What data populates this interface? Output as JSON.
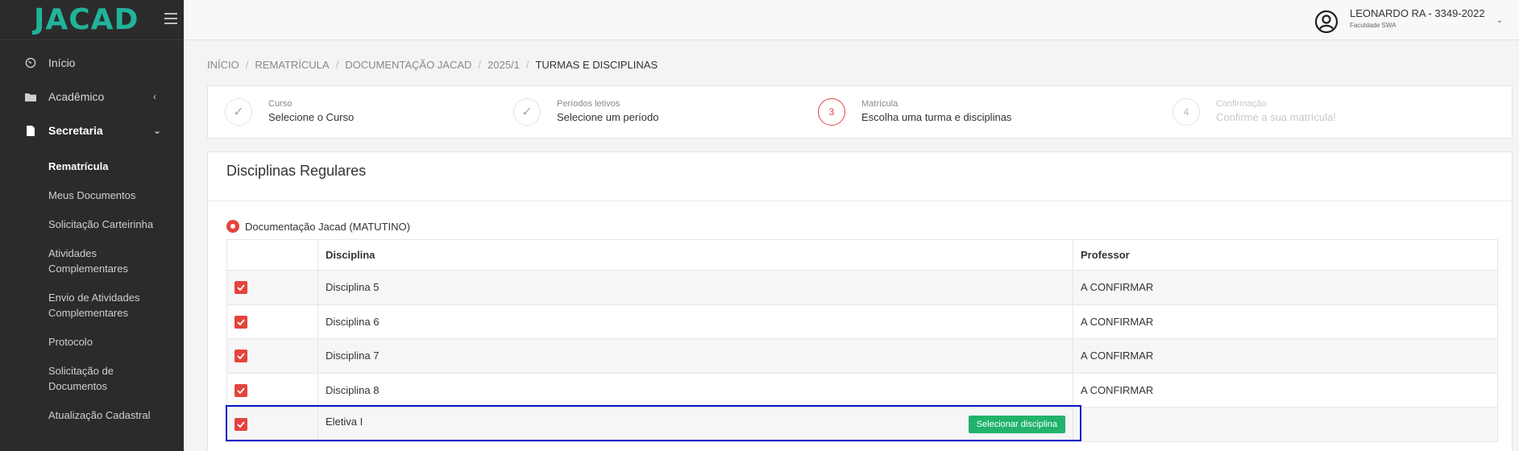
{
  "brand": {
    "logo": "JACAD"
  },
  "sidebar": {
    "items": [
      {
        "label": "Início",
        "icon": "dashboard-gauge-icon"
      },
      {
        "label": "Acadêmico",
        "icon": "folder-icon",
        "arrow": "‹"
      },
      {
        "label": "Secretaria",
        "icon": "document-icon",
        "arrow": "⌄"
      }
    ],
    "secretaria_sub": [
      "Rematrícula",
      "Meus Documentos",
      "Solicitação Carteirinha",
      "Atividades Complementares",
      "Envio de Atividades Complementares",
      "Protocolo",
      "Solicitação de Documentos",
      "Atualização Cadastral"
    ]
  },
  "user": {
    "name": "LEONARDO RA - 3349-2022",
    "institution": "Faculdade SWA",
    "icon": "user-circle-icon"
  },
  "breadcrumb": {
    "items": [
      "INÍCIO",
      "REMATRÍCULA",
      "DOCUMENTAÇÃO JACAD",
      "2025/1",
      "TURMAS E DISCIPLINAS"
    ],
    "separator": "/"
  },
  "steps": [
    {
      "status": "done",
      "marker": "✓",
      "title": "Curso",
      "desc": "Selecione o Curso"
    },
    {
      "status": "done",
      "marker": "✓",
      "title": "Períodos letivos",
      "desc": "Selecione um período"
    },
    {
      "status": "current",
      "marker": "3",
      "title": "Matrícula",
      "desc": "Escolha uma turma e disciplinas"
    },
    {
      "status": "todo",
      "marker": "4",
      "title": "Confirmação",
      "desc": "Confirme a sua matrícula!"
    }
  ],
  "section": {
    "title": "Disciplinas Regulares",
    "turma": "Documentação Jacad (MATUTINO)"
  },
  "table": {
    "headers": [
      "",
      "Disciplina",
      "Professor"
    ],
    "rows": [
      {
        "checked": true,
        "disciplina": "Disciplina 5",
        "professor": "A CONFIRMAR"
      },
      {
        "checked": true,
        "disciplina": "Disciplina 6",
        "professor": "A CONFIRMAR"
      },
      {
        "checked": true,
        "disciplina": "Disciplina 7",
        "professor": "A CONFIRMAR"
      },
      {
        "checked": true,
        "disciplina": "Disciplina 8",
        "professor": "A CONFIRMAR"
      },
      {
        "checked": true,
        "disciplina": "Eletiva I",
        "professor": "",
        "button": "Selecionar disciplina"
      }
    ]
  },
  "colors": {
    "accent": "#e4443d",
    "brand": "#21b39a",
    "button": "#21b36b",
    "highlight": "#0a17c9",
    "sidebar": "#2b2b2b"
  }
}
